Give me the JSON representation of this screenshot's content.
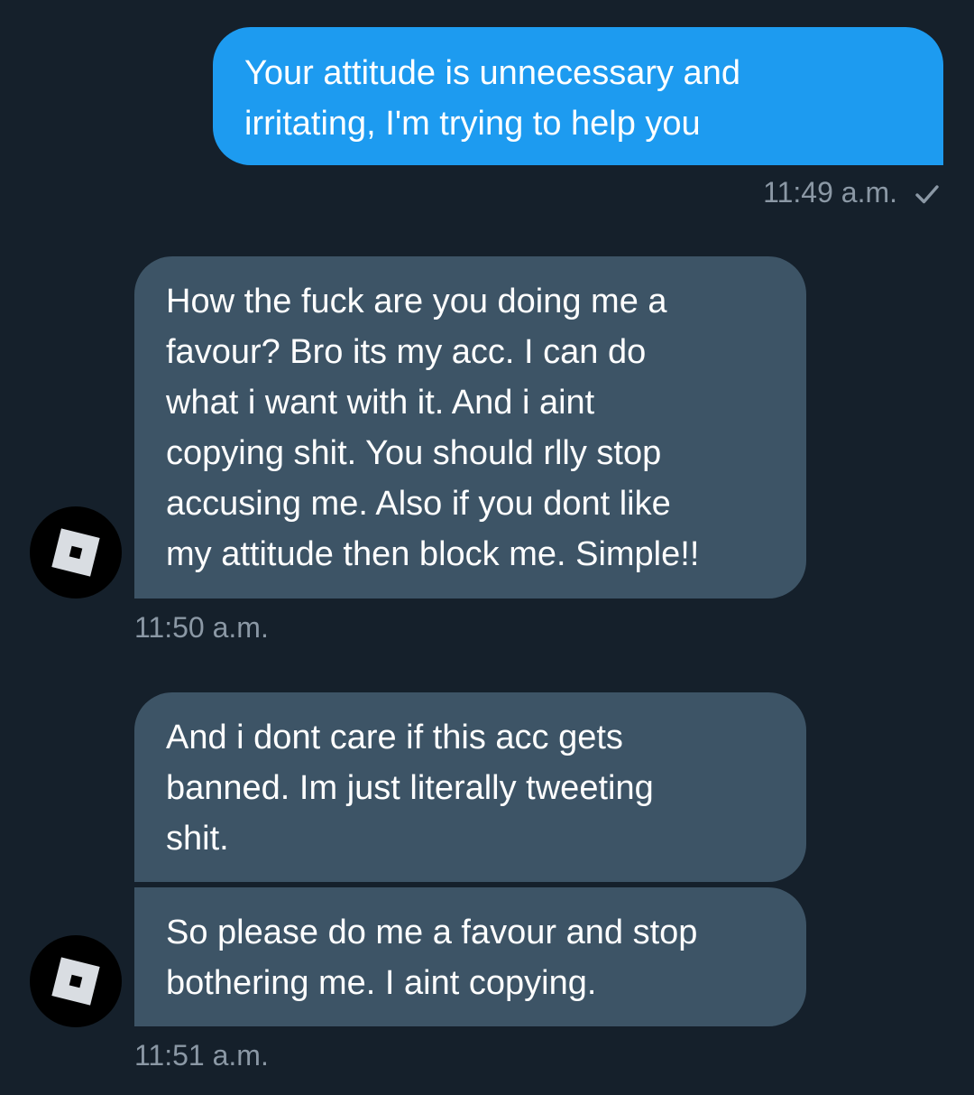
{
  "conversation": {
    "messages": [
      {
        "direction": "sent",
        "text": "Your attitude is unnecessary and\nirritating, I'm trying to help you",
        "timestamp": "11:49 a.m.",
        "status_icon": "checkmark-icon"
      },
      {
        "direction": "received",
        "text": "How the fuck are you doing me a\nfavour? Bro its my acc. I can do\nwhat i want with it. And i aint\ncopying shit. You should rlly stop\naccusing me. Also if you dont like\nmy attitude then block me. Simple!!",
        "timestamp": "11:50 a.m.",
        "avatar_icon": "roblox-logo-icon"
      },
      {
        "direction": "received",
        "text": "And i dont care if this acc gets\nbanned. Im just literally tweeting\nshit."
      },
      {
        "direction": "received",
        "text": "So please do me a favour and stop\nbothering me. I aint copying.",
        "timestamp": "11:51 a.m.",
        "avatar_icon": "roblox-logo-icon"
      }
    ]
  },
  "colors": {
    "background": "#15202b",
    "sent_bubble": "#1d9bf0",
    "received_bubble": "#3d5466",
    "timestamp_text": "#8b98a5"
  }
}
